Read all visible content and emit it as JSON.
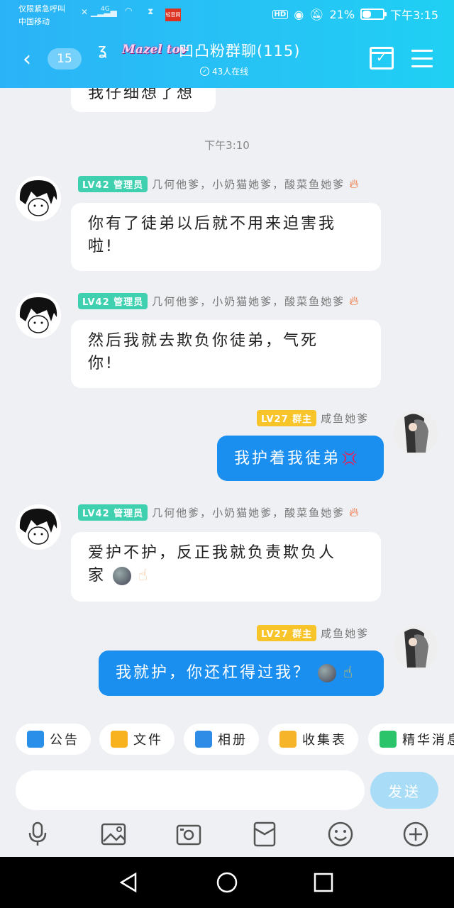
{
  "status": {
    "carrier_line1": "仅限紧急呼叫",
    "carrier_line2": "中国移动",
    "net": "4G",
    "battery": "21%",
    "time": "下午3:15",
    "hd": "HD",
    "app_badge": "轻音网"
  },
  "header": {
    "back_icon": "chevron-left-icon",
    "unread": "15",
    "brand": "Mazel tov",
    "title": "凹凸粉群聊(115)",
    "online": "43人在线"
  },
  "chat": {
    "earlier_text": "我仔细想了想",
    "timestamp": "下午3:10",
    "messages": [
      {
        "level": "LV42 管理员",
        "name": "几何他爹，小奶猫她爹，酸菜鱼她爹",
        "line1": "你有了徒弟以后就不用来迫害我",
        "line2": "啦!"
      },
      {
        "level": "LV42 管理员",
        "name": "几何他爹，小奶猫她爹，酸菜鱼她爹",
        "line1": "然后我就去欺负你徒弟，气死",
        "line2": "你!"
      },
      {
        "level": "LV27 群主",
        "name": "咸鱼她爹",
        "text": "我护着我徒弟"
      },
      {
        "level": "LV42 管理员",
        "name": "几何他爹，小奶猫她爹，酸菜鱼她爹",
        "line1": "爱护不护，反正我就负责欺负人",
        "line2": "家"
      },
      {
        "level": "LV27 群主",
        "name": "咸鱼她爹",
        "text": "我就护，你还杠得过我？"
      }
    ]
  },
  "quick": [
    "公告",
    "文件",
    "相册",
    "收集表",
    "精华消息"
  ],
  "input": {
    "placeholder": "",
    "send": "发送"
  },
  "colors": {
    "accent": "#1a8ff0",
    "header": "#2bb3f7",
    "admin": "#3fd0b0",
    "owner": "#f7c52a"
  }
}
